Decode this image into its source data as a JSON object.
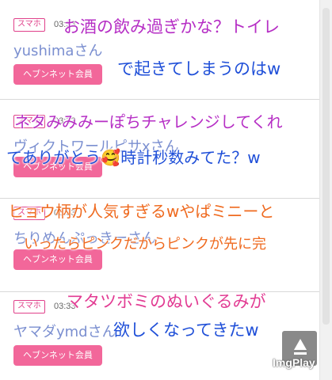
{
  "posts": [
    {
      "tag": "スマホ",
      "time": "03:33",
      "name": "yushimaさん",
      "member_button": "ヘブンネット会員"
    },
    {
      "tag": "スマホ",
      "time": "03:33",
      "name": "ヴィクトワールピサxさん",
      "member_button": "ヘブンネット会員"
    },
    {
      "tag": "スマホ",
      "time": "03:33",
      "name": "ちりめんぷっきーさん",
      "member_button": "ヘブンネット会員"
    },
    {
      "tag": "スマホ",
      "time": "03:33",
      "name": "ヤマダymdさん",
      "member_button": "ヘブンネット会員"
    }
  ],
  "comments": [
    {
      "text": "お酒の飲み過ぎかな？トイレ",
      "color": "#b62fc5"
    },
    {
      "text": "で起きてしまうのはw",
      "color": "#1f4fd8"
    },
    {
      "text": "ネタみみみーぽちチャレンジしてくれ",
      "color": "#b62fc5"
    },
    {
      "text": "てありがとう🥰時計秒数みてた？w",
      "color": "#1f4fd8"
    },
    {
      "text": "ヒョウ柄が人気すぎるwやぱミニーと",
      "color": "#ef6a1f"
    },
    {
      "text": "いったらピンクだからピンクが先に完",
      "color": "#ef6a1f"
    },
    {
      "text": "マタツボミのぬいぐるみが",
      "color": "#e23c93"
    },
    {
      "text": "欲しくなってきたw",
      "color": "#1f4fd8"
    }
  ],
  "watermark": "ImgPlay",
  "icons": {
    "play": "play-icon"
  }
}
